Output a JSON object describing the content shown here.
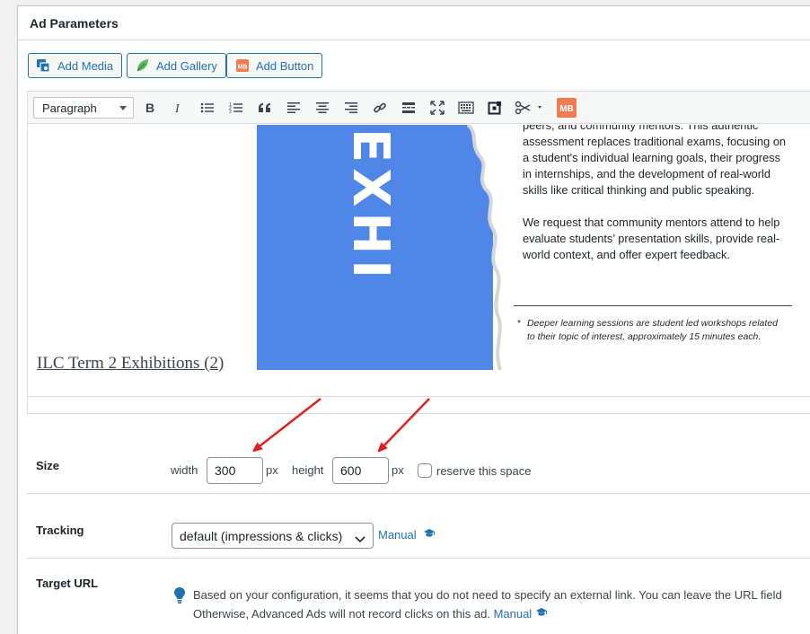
{
  "panel": {
    "title": "Ad Parameters"
  },
  "media_buttons": [
    {
      "label": "Add Media",
      "icon": "media-icon"
    },
    {
      "label": "Add Gallery",
      "icon": "leaf-icon"
    },
    {
      "label": "Add Button",
      "icon": "mb-icon"
    }
  ],
  "toolbar": {
    "format": "Paragraph",
    "mb_badge": "MB"
  },
  "poster": {
    "vertical_word": "EXHI",
    "paragraph1": "peers, and community mentors. This authentic assessment replaces traditional exams, focusing on a student's individual learning goals, their progress in internships, and the development of real-world skills like critical thinking and public speaking.",
    "paragraph2": "We request that community mentors attend to help evaluate students’ presentation skills, provide real-world context, and offer expert feedback.",
    "bullet": "*",
    "note": "Deeper learning sessions are student led workshops related to their topic of interest, approximately 15 minutes each.",
    "caption": "ILC Term 2 Exhibitions (2)"
  },
  "size": {
    "label": "Size",
    "width_label": "width",
    "width_value": "300",
    "unit1": "px",
    "height_label": "height",
    "height_value": "600",
    "unit2": "px",
    "reserve_label": "reserve this space"
  },
  "tracking": {
    "label": "Tracking",
    "selected": "default (impressions & clicks)",
    "manual": "Manual"
  },
  "target_url": {
    "label": "Target URL",
    "line1": "Based on your configuration, it seems that you do not need to specify an external link. You can leave the URL field",
    "line2": "Otherwise, Advanced Ads will not record clicks on this ad.",
    "manual": "Manual"
  },
  "colors": {
    "accent": "#2271b1",
    "poster_blue": "#4f86e8",
    "arrow": "#e02020",
    "mb_orange": "#f07b4f"
  }
}
